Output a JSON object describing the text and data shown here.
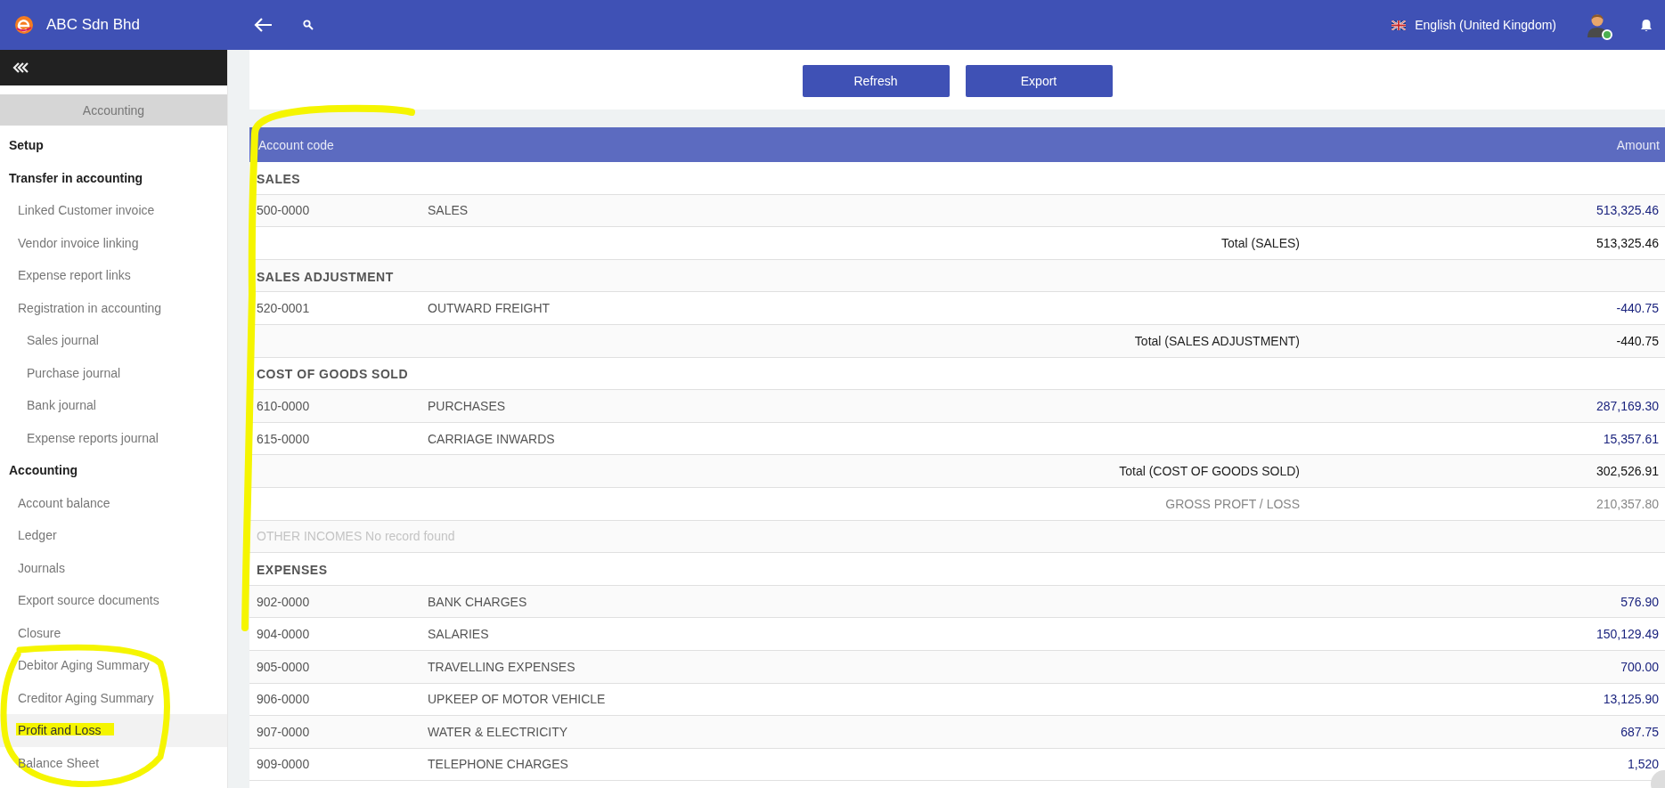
{
  "app": {
    "company": "ABC Sdn Bhd",
    "language": "English (United Kingdom)",
    "user": {
      "online": true
    }
  },
  "sidebar": {
    "title": "Accounting",
    "items": [
      {
        "label": "Setup",
        "selected": false
      },
      {
        "label": "Transfer in accounting",
        "selected": false,
        "children": [
          {
            "label": "Linked Customer invoice",
            "selected": false
          },
          {
            "label": "Vendor invoice linking",
            "selected": false
          },
          {
            "label": "Expense report links",
            "selected": false
          },
          {
            "label": "Registration in accounting",
            "selected": false,
            "children": [
              {
                "label": "Sales journal",
                "selected": false
              },
              {
                "label": "Purchase journal",
                "selected": false
              },
              {
                "label": "Bank journal",
                "selected": false
              },
              {
                "label": "Expense reports journal",
                "selected": false
              }
            ]
          }
        ]
      },
      {
        "label": "Accounting",
        "selected": false,
        "children": [
          {
            "label": "Account balance",
            "selected": false
          },
          {
            "label": "Ledger",
            "selected": false
          },
          {
            "label": "Journals",
            "selected": false
          },
          {
            "label": "Export source documents",
            "selected": false
          },
          {
            "label": "Closure",
            "selected": false
          },
          {
            "label": "Debitor Aging Summary",
            "selected": false
          },
          {
            "label": "Creditor Aging Summary",
            "selected": false
          },
          {
            "label": "Profit and Loss",
            "selected": true
          },
          {
            "label": "Balance Sheet",
            "selected": false
          }
        ]
      }
    ]
  },
  "buttons": [
    "Refresh",
    "Export"
  ],
  "table": {
    "columns": [
      "Account code",
      "Amount"
    ],
    "rows": [
      {
        "kind": "section",
        "label": "SALES"
      },
      {
        "kind": "account",
        "code": "500-0000",
        "name": "SALES",
        "amount": "513,325.46"
      },
      {
        "kind": "total",
        "label": "Total (SALES)",
        "amount": "513,325.46"
      },
      {
        "kind": "section",
        "label": "SALES ADJUSTMENT"
      },
      {
        "kind": "account",
        "code": "520-0001",
        "name": "OUTWARD FREIGHT",
        "amount": "-440.75"
      },
      {
        "kind": "total",
        "label": "Total (SALES ADJUSTMENT)",
        "amount": "-440.75"
      },
      {
        "kind": "section",
        "label": "COST OF GOODS SOLD"
      },
      {
        "kind": "account",
        "code": "610-0000",
        "name": "PURCHASES",
        "amount": "287,169.30"
      },
      {
        "kind": "account",
        "code": "615-0000",
        "name": "CARRIAGE INWARDS",
        "amount": "15,357.61"
      },
      {
        "kind": "total",
        "label": "Total (COST OF GOODS SOLD)",
        "amount": "302,526.91"
      },
      {
        "kind": "result",
        "label": "GROSS PROFT / LOSS",
        "amount": "210,357.80"
      },
      {
        "kind": "empty",
        "label": "OTHER INCOMES No record found"
      },
      {
        "kind": "section",
        "label": "EXPENSES"
      },
      {
        "kind": "account",
        "code": "902-0000",
        "name": "BANK CHARGES",
        "amount": "576.90"
      },
      {
        "kind": "account",
        "code": "904-0000",
        "name": "SALARIES",
        "amount": "150,129.49"
      },
      {
        "kind": "account",
        "code": "905-0000",
        "name": "TRAVELLING EXPENSES",
        "amount": "700.00"
      },
      {
        "kind": "account",
        "code": "906-0000",
        "name": "UPKEEP OF MOTOR VEHICLE",
        "amount": "13,125.90"
      },
      {
        "kind": "account",
        "code": "907-0000",
        "name": "WATER & ELECTRICITY",
        "amount": "687.75"
      },
      {
        "kind": "account",
        "code": "909-0000",
        "name": "TELEPHONE CHARGES",
        "amount": "1,520"
      }
    ]
  }
}
